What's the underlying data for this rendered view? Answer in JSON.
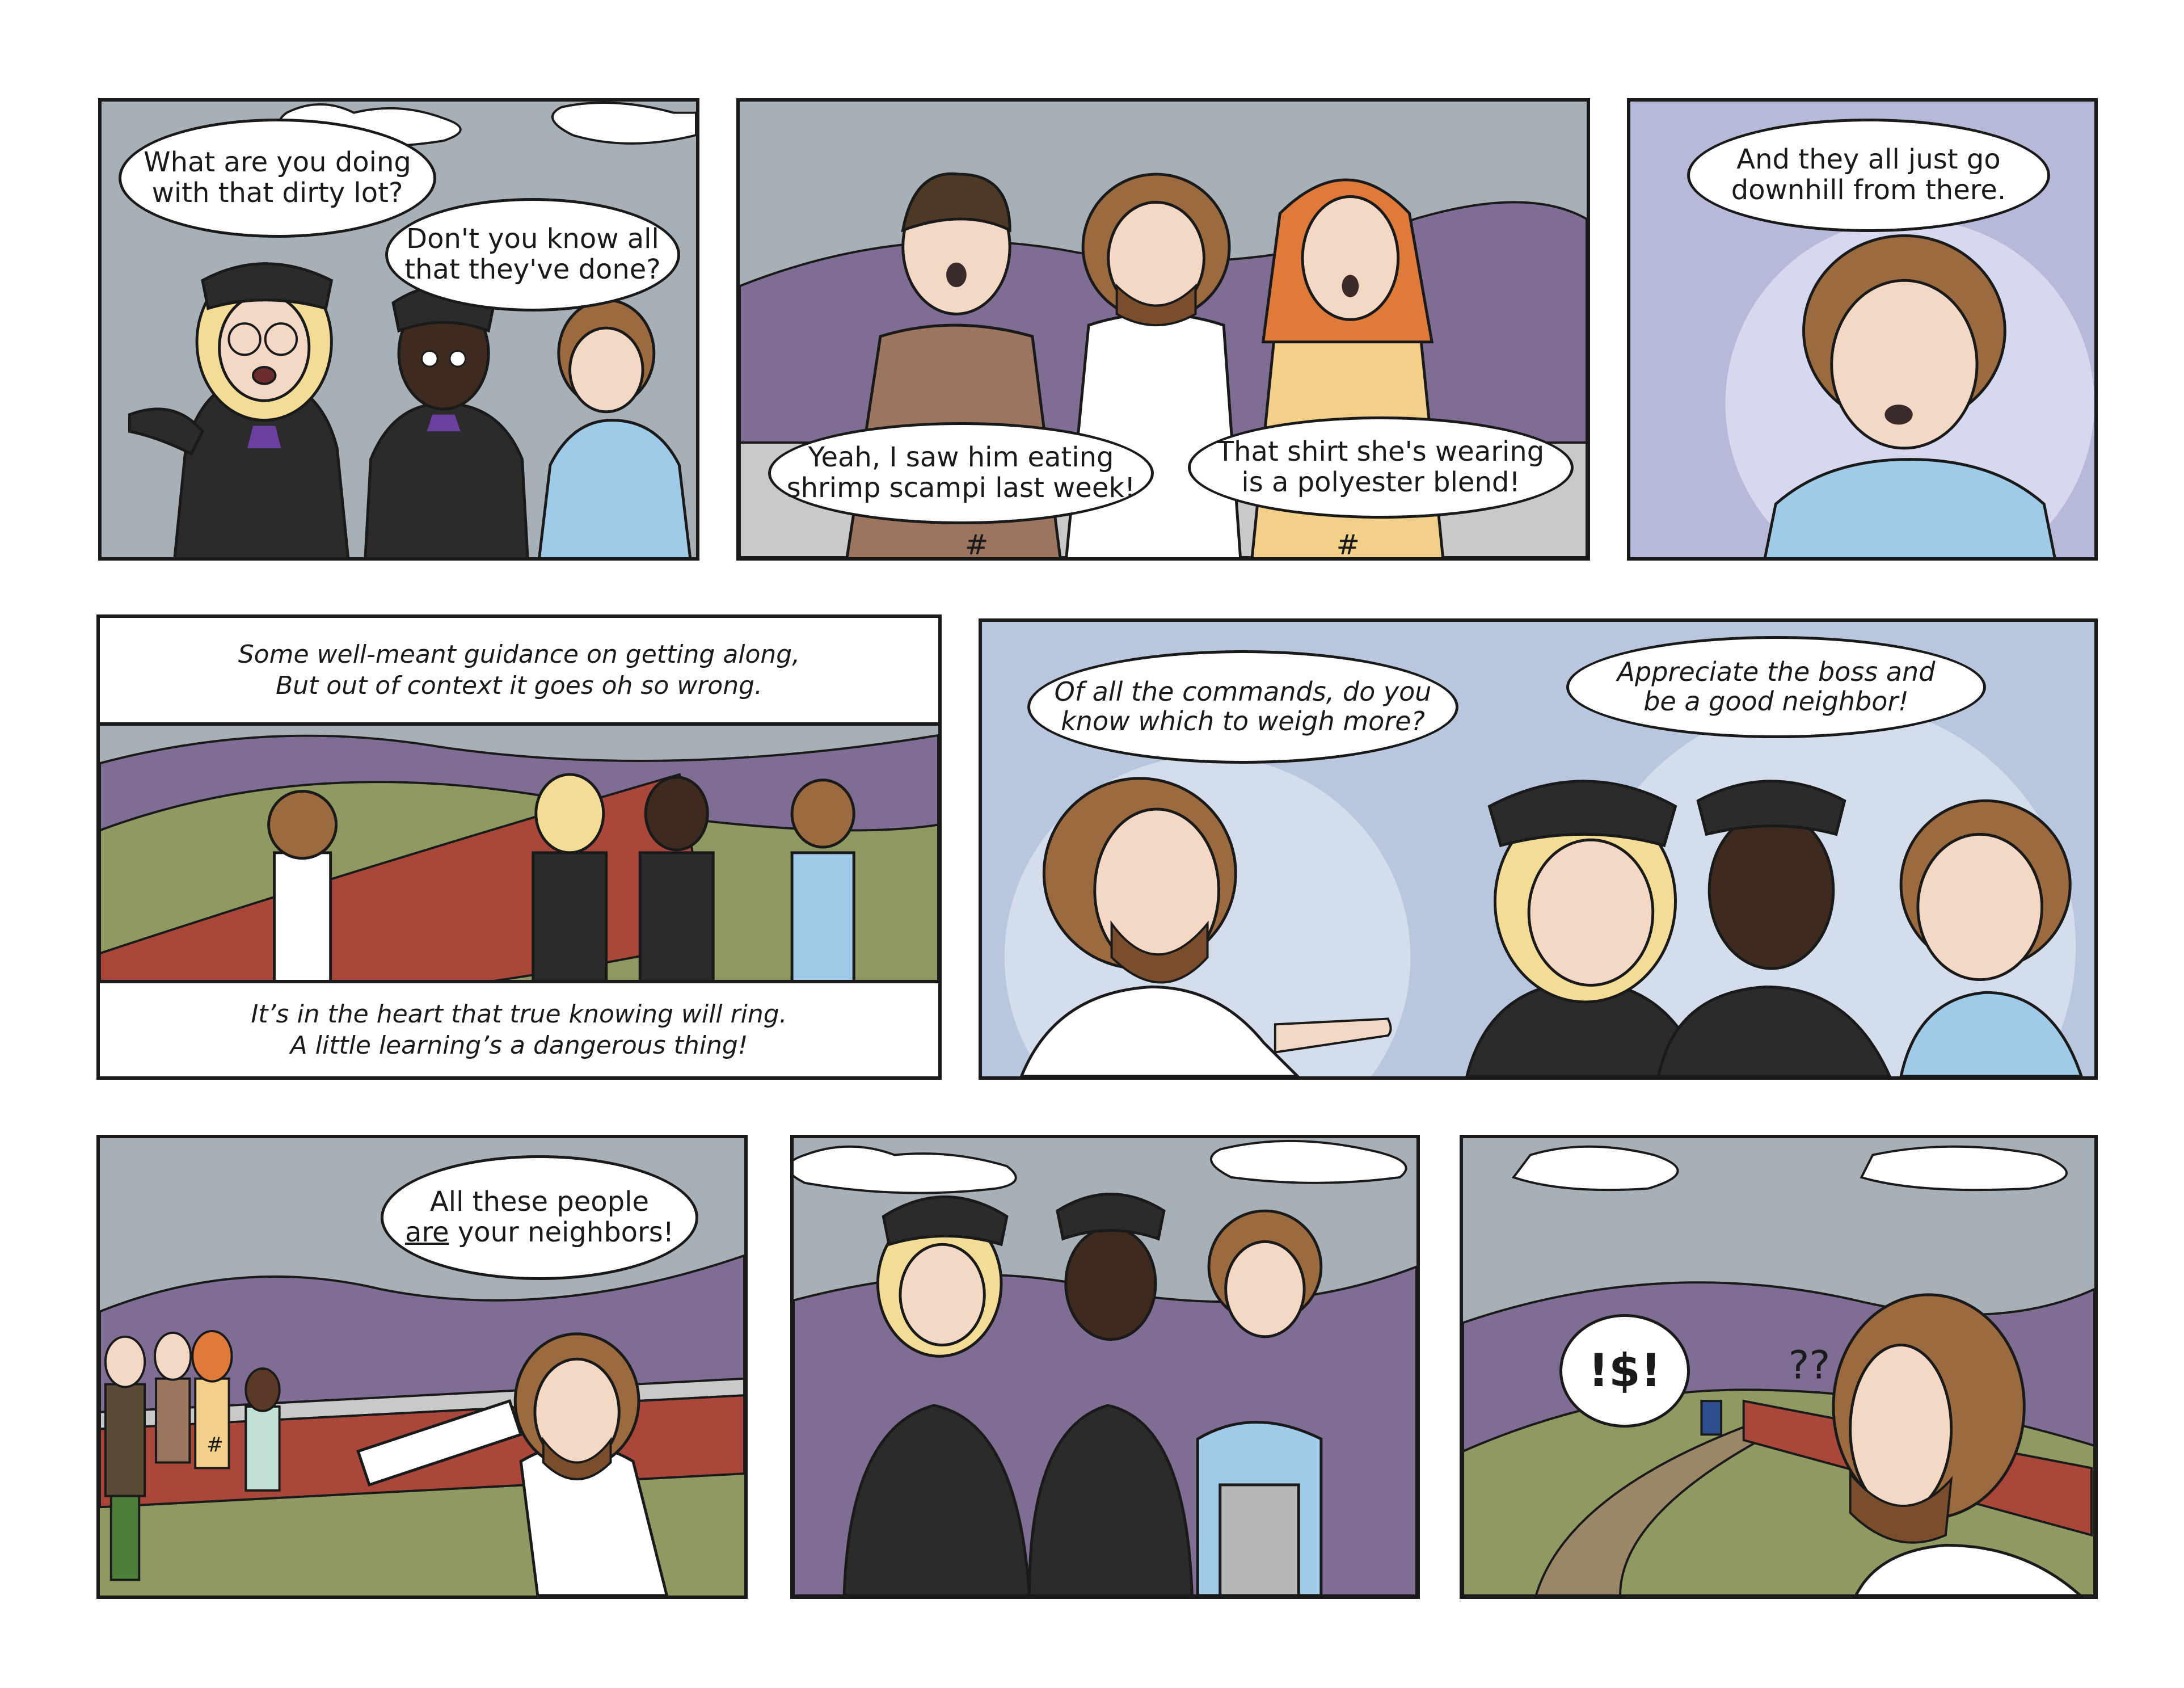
{
  "panels": {
    "p1": {
      "bubble1": [
        "What are you doing",
        "with that dirty lot?"
      ],
      "bubble2": [
        "Don't you know all",
        "that they've done?"
      ]
    },
    "p2": {
      "bubble1": [
        "Yeah, I saw him eating",
        "shrimp scampi last week!"
      ],
      "bubble2": [
        "That shirt she's wearing",
        "is a polyester blend!"
      ],
      "shirt_mark_1": "#",
      "shirt_mark_2": "#"
    },
    "p3": {
      "bubble1": [
        "And they all just go",
        "downhill from there."
      ]
    },
    "p4": {
      "caption_top": [
        "Some well-meant guidance on getting along,",
        "But out of context it goes oh so wrong."
      ],
      "caption_bottom": [
        "It’s in the heart that true knowing will ring.",
        "A little learning’s a dangerous thing!"
      ]
    },
    "p5": {
      "bubble1": [
        "Of all the commands, do you",
        "know which to weigh more?"
      ],
      "bubble2": [
        "Appreciate the boss and",
        "be a good neighbor!"
      ]
    },
    "p6": {
      "bubble1_line1": "All these people",
      "bubble1_line2_emph": "are",
      "bubble1_line2_rest": " your neighbors!",
      "shirt_mark": "#"
    },
    "p8": {
      "bubble1": "!$!",
      "question": "??"
    }
  },
  "colors": {
    "sky": "#a7b0b6",
    "hills_purple": "#7f6d93",
    "grass": "#8f9a63",
    "bg_lavender": "#b6bad8",
    "bg_blue": "#b8c7de",
    "brick": "#a9483a",
    "robe": "#2b2b2b",
    "ink": "#1a1a1a"
  }
}
